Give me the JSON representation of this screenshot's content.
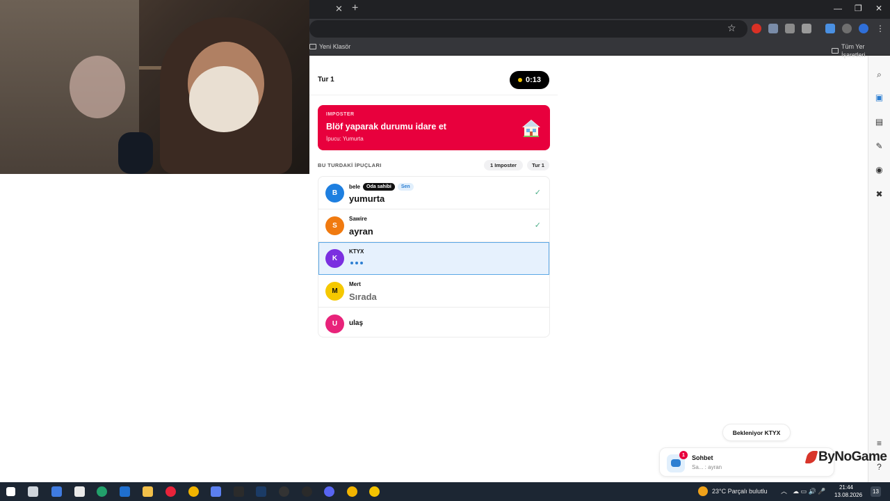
{
  "browser": {
    "bookmarks": [
      {
        "label": "Yeni Klasör"
      },
      {
        "label": "Tüm Yer İşaretleri"
      }
    ]
  },
  "game": {
    "round_title": "Tur 1",
    "timer": "0:13",
    "role_card": {
      "tag": "IMPOSTER",
      "title": "Blöf yaparak durumu idare et",
      "hint": "İpucu: Yumurta",
      "accent_color": "#e8003d"
    },
    "clues": {
      "title": "BU TURDAKİ İPUÇLARI",
      "imposter_count": "1 Imposter",
      "round_badge": "Tur 1"
    },
    "players": [
      {
        "initial": "B",
        "name": "bele",
        "owner_badge": "Oda sahibi",
        "you_badge": "Sen",
        "clue": "yumurta",
        "color": "#1e7fe0",
        "done": true
      },
      {
        "initial": "S",
        "name": "Sawire",
        "clue": "ayran",
        "color": "#f07a10",
        "done": true
      },
      {
        "initial": "K",
        "name": "KTYX",
        "color": "#7b2fe0",
        "typing": true
      },
      {
        "initial": "M",
        "name": "Mert",
        "clue": "Sırada",
        "color": "#f5c800"
      },
      {
        "initial": "U",
        "name": "ulaş",
        "color": "#e8237a"
      }
    ]
  },
  "chat": {
    "waiting_label": "Bekleniyor KTYX",
    "title": "Sohbet",
    "preview": "Sa... : ayran",
    "unread": "1"
  },
  "watermark": "ByNoGame",
  "taskbar": {
    "weather": "23°C  Parçalı bulutlu",
    "time": "21:44",
    "date": "13.08.2026",
    "notif": "13"
  }
}
